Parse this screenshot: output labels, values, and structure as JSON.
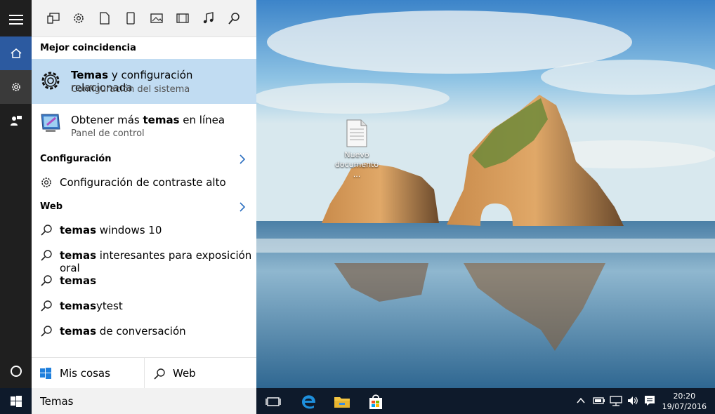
{
  "panel": {
    "best_match_title": "Mejor coincidencia",
    "best_match": {
      "title_bold": "Temas",
      "title_rest": " y configuración relacionada",
      "subtitle": "Configuración del sistema"
    },
    "second": {
      "title_pre": "Obtener más ",
      "title_bold": "temas",
      "title_post": " en línea",
      "subtitle": "Panel de control"
    },
    "config_title": "Configuración",
    "config_items": [
      "Configuración de contraste alto"
    ],
    "web_title": "Web",
    "web_items": [
      {
        "bold": "temas",
        "rest": " windows 10"
      },
      {
        "bold": "temas",
        "rest": " interesantes para exposición oral"
      },
      {
        "bold": "temas",
        "rest": ""
      },
      {
        "bold": "temas",
        "rest": "ytest"
      },
      {
        "bold": "temas",
        "rest": " de conversación"
      }
    ],
    "tab_my_stuff": "Mis cosas",
    "tab_web": "Web"
  },
  "search": {
    "value": "Temas"
  },
  "desktop": {
    "icon_label": "Nuevo documento ..."
  },
  "clock": {
    "time": "20:20",
    "date": "19/07/2016"
  },
  "colors": {
    "accent": "#2c5aa0",
    "selection": "#c1dcf2",
    "taskbar": "#0e1a2b",
    "rail": "#1f1f1f"
  },
  "icons": {
    "rail": [
      "hamburger-icon",
      "home-icon",
      "gear-icon",
      "feedback-icon",
      "cortana-circle-icon"
    ],
    "filters": [
      "apps-icon",
      "settings-icon",
      "document-icon",
      "phone-icon",
      "photo-icon",
      "video-icon",
      "music-icon",
      "search-icon"
    ],
    "taskbar": [
      "windows-icon",
      "task-view-icon",
      "edge-icon",
      "file-explorer-icon",
      "store-icon"
    ],
    "tray": [
      "chevron-up-icon",
      "battery-icon",
      "network-icon",
      "volume-icon",
      "action-center-icon"
    ]
  }
}
